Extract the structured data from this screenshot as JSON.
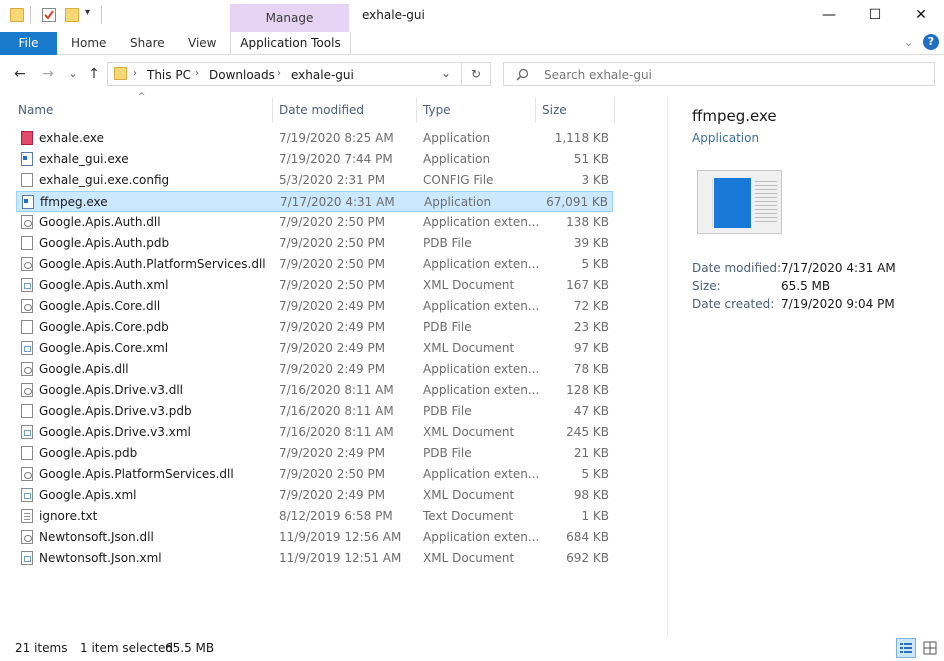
{
  "window": {
    "title": "exhale-gui",
    "context_tab": "Manage",
    "minimize": "—",
    "maximize": "☐",
    "close": "✕"
  },
  "ribbon": {
    "file": "File",
    "tabs": [
      "Home",
      "Share",
      "View"
    ],
    "app_tools": "Application Tools",
    "help": "?"
  },
  "nav": {
    "back": "←",
    "forward": "→",
    "recent": "⌄",
    "up": "↑",
    "breadcrumb": [
      "This PC",
      "Downloads",
      "exhale-gui"
    ],
    "refresh": "↻",
    "search_placeholder": "Search exhale-gui"
  },
  "columns": {
    "name": "Name",
    "date": "Date modified",
    "type": "Type",
    "size": "Size"
  },
  "files": [
    {
      "name": "exhale.exe",
      "date": "7/19/2020 8:25 AM",
      "type": "Application",
      "size": "1,118 KB",
      "icon": "exhale-app-icon"
    },
    {
      "name": "exhale_gui.exe",
      "date": "7/19/2020 7:44 PM",
      "type": "Application",
      "size": "51 KB",
      "icon": "exe-icon"
    },
    {
      "name": "exhale_gui.exe.config",
      "date": "5/3/2020 2:31 PM",
      "type": "CONFIG File",
      "size": "3 KB",
      "icon": "config-file-icon"
    },
    {
      "name": "ffmpeg.exe",
      "date": "7/17/2020 4:31 AM",
      "type": "Application",
      "size": "67,091 KB",
      "icon": "exe-icon",
      "selected": true
    },
    {
      "name": "Google.Apis.Auth.dll",
      "date": "7/9/2020 2:50 PM",
      "type": "Application exten...",
      "size": "138 KB",
      "icon": "dll-icon"
    },
    {
      "name": "Google.Apis.Auth.pdb",
      "date": "7/9/2020 2:50 PM",
      "type": "PDB File",
      "size": "39 KB",
      "icon": "pdb-file-icon"
    },
    {
      "name": "Google.Apis.Auth.PlatformServices.dll",
      "date": "7/9/2020 2:50 PM",
      "type": "Application exten...",
      "size": "5 KB",
      "icon": "dll-icon"
    },
    {
      "name": "Google.Apis.Auth.xml",
      "date": "7/9/2020 2:50 PM",
      "type": "XML Document",
      "size": "167 KB",
      "icon": "xml-icon"
    },
    {
      "name": "Google.Apis.Core.dll",
      "date": "7/9/2020 2:49 PM",
      "type": "Application exten...",
      "size": "72 KB",
      "icon": "dll-icon"
    },
    {
      "name": "Google.Apis.Core.pdb",
      "date": "7/9/2020 2:49 PM",
      "type": "PDB File",
      "size": "23 KB",
      "icon": "pdb-file-icon"
    },
    {
      "name": "Google.Apis.Core.xml",
      "date": "7/9/2020 2:49 PM",
      "type": "XML Document",
      "size": "97 KB",
      "icon": "xml-icon"
    },
    {
      "name": "Google.Apis.dll",
      "date": "7/9/2020 2:49 PM",
      "type": "Application exten...",
      "size": "78 KB",
      "icon": "dll-icon"
    },
    {
      "name": "Google.Apis.Drive.v3.dll",
      "date": "7/16/2020 8:11 AM",
      "type": "Application exten...",
      "size": "128 KB",
      "icon": "dll-icon"
    },
    {
      "name": "Google.Apis.Drive.v3.pdb",
      "date": "7/16/2020 8:11 AM",
      "type": "PDB File",
      "size": "47 KB",
      "icon": "pdb-file-icon"
    },
    {
      "name": "Google.Apis.Drive.v3.xml",
      "date": "7/16/2020 8:11 AM",
      "type": "XML Document",
      "size": "245 KB",
      "icon": "xml-icon"
    },
    {
      "name": "Google.Apis.pdb",
      "date": "7/9/2020 2:49 PM",
      "type": "PDB File",
      "size": "21 KB",
      "icon": "pdb-file-icon"
    },
    {
      "name": "Google.Apis.PlatformServices.dll",
      "date": "7/9/2020 2:50 PM",
      "type": "Application exten...",
      "size": "5 KB",
      "icon": "dll-icon"
    },
    {
      "name": "Google.Apis.xml",
      "date": "7/9/2020 2:49 PM",
      "type": "XML Document",
      "size": "98 KB",
      "icon": "xml-icon"
    },
    {
      "name": "ignore.txt",
      "date": "8/12/2019 6:58 PM",
      "type": "Text Document",
      "size": "1 KB",
      "icon": "text-file-icon"
    },
    {
      "name": "Newtonsoft.Json.dll",
      "date": "11/9/2019 12:56 AM",
      "type": "Application exten...",
      "size": "684 KB",
      "icon": "dll-icon"
    },
    {
      "name": "Newtonsoft.Json.xml",
      "date": "11/9/2019 12:51 AM",
      "type": "XML Document",
      "size": "692 KB",
      "icon": "xml-icon"
    }
  ],
  "preview": {
    "name": "ffmpeg.exe",
    "type": "Application",
    "date_modified_label": "Date modified:",
    "date_modified": "7/17/2020 4:31 AM",
    "size_label": "Size:",
    "size": "65.5 MB",
    "date_created_label": "Date created:",
    "date_created": "7/19/2020 9:04 PM"
  },
  "status": {
    "items": "21 items",
    "selected": "1 item selected",
    "selected_size": "65.5 MB"
  },
  "colors": {
    "accent": "#1979ca",
    "selection": "#cce8ff",
    "manage_tab": "#e7d3f3"
  }
}
